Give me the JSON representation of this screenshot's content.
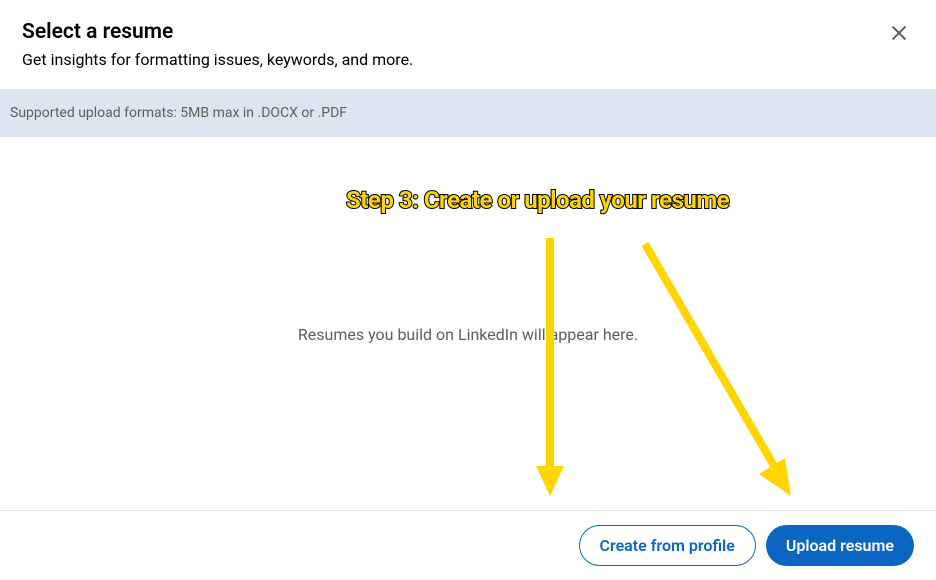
{
  "header": {
    "title": "Select a resume",
    "subtitle": "Get insights for formatting issues, keywords, and more."
  },
  "banner": {
    "text": "Supported upload formats: 5MB max in .DOCX or .PDF"
  },
  "emptyState": {
    "message": "Resumes you build on LinkedIn will appear here."
  },
  "footer": {
    "createButton": "Create from profile",
    "uploadButton": "Upload resume"
  },
  "annotation": {
    "text": "Step 3: Create or upload your resume"
  },
  "colors": {
    "primary": "#0a66c2",
    "bannerBg": "#dce6f1",
    "annotationYellow": "#ffd500"
  }
}
